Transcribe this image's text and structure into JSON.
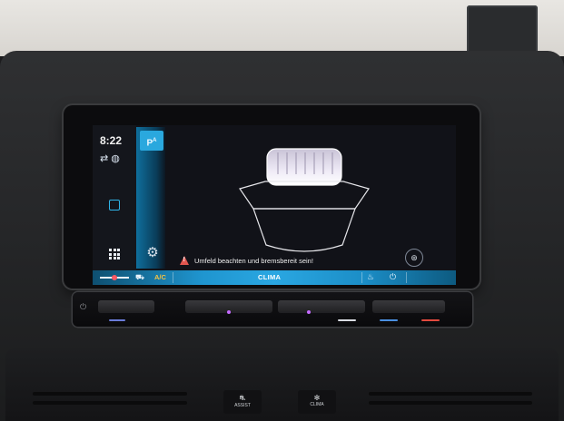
{
  "screen": {
    "clock": "8:22",
    "status_icons": [
      "car-connect-icon",
      "globe-icon"
    ],
    "park_button_label": "P",
    "park_button_sub": "A"
  },
  "park_assist": {
    "alert_icon": "warning-icon",
    "alert_text": "Umfeld beachten und bremsbereit sein!",
    "sensor_button_icon": "car-sensor-icon"
  },
  "bottom_bar": {
    "ac_label": "A/C",
    "clima_label": "CLIMA"
  },
  "console_buttons": [
    {
      "label": "ASSIST",
      "icon": "assist-icon"
    },
    {
      "label": "CLIMA",
      "icon": "fan-icon"
    }
  ],
  "colors": {
    "accent_blue": "#2aa8de",
    "warning_red": "#e0564f",
    "ac_yellow": "#f6c343"
  }
}
